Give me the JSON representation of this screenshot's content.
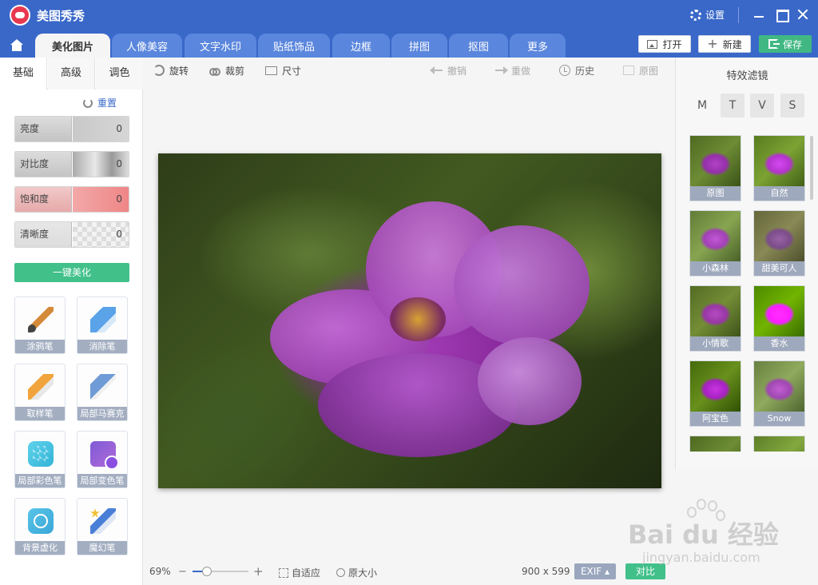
{
  "app": {
    "title": "美图秀秀",
    "settings": "设置"
  },
  "tabs": [
    "美化图片",
    "人像美容",
    "文字水印",
    "贴纸饰品",
    "边框",
    "拼图",
    "抠图",
    "更多"
  ],
  "header_buttons": {
    "open": "打开",
    "new": "新建",
    "save": "保存"
  },
  "left_panel": {
    "subtabs": [
      "基础",
      "高级",
      "调色"
    ],
    "reset": "重置",
    "sliders": [
      {
        "label": "亮度",
        "value": "0"
      },
      {
        "label": "对比度",
        "value": "0"
      },
      {
        "label": "饱和度",
        "value": "0"
      },
      {
        "label": "清晰度",
        "value": "0"
      }
    ],
    "one_click": "一键美化",
    "tools": [
      "涂鸦笔",
      "消除笔",
      "取样笔",
      "局部马赛克",
      "局部彩色笔",
      "局部变色笔",
      "背景虚化",
      "魔幻笔"
    ]
  },
  "toolbar": {
    "rotate": "旋转",
    "crop": "裁剪",
    "size": "尺寸",
    "undo": "撤销",
    "redo": "重做",
    "history": "历史",
    "original": "原图"
  },
  "right_panel": {
    "title": "特效滤镜",
    "filter_tabs": [
      "M",
      "T",
      "V",
      "S"
    ],
    "filters": [
      "原图",
      "自然",
      "小森林",
      "甜美可人",
      "小情歌",
      "香水",
      "阿宝色",
      "Snow"
    ]
  },
  "bottom_bar": {
    "zoom": "69%",
    "zoom_level": 0.25,
    "fit": "自适应",
    "original_size": "原大小",
    "dimensions": "900 x 599",
    "exif": "EXIF ▴",
    "compare": "对比"
  },
  "watermark": {
    "main": "Bai du 经验",
    "sub": "jingyan.baidu.com"
  }
}
